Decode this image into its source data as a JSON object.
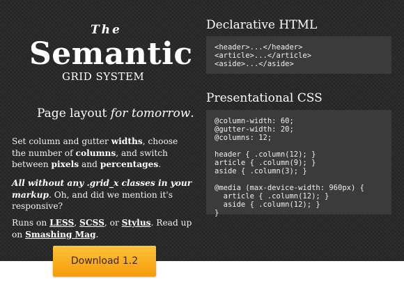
{
  "hero": {
    "the": "The",
    "title": "Semantic",
    "subtitle": "GRID SYSTEM",
    "tagline_prefix": "Page layout ",
    "tagline_emphasis": "for tomorrow",
    "tagline_suffix": "."
  },
  "intro": {
    "t1": "Set column and gutter ",
    "b1": "widths",
    "t2": ", choose the number of ",
    "b2": "columns",
    "t3": ", and switch between ",
    "b3": "pixels",
    "t4": " and ",
    "b4": "percentages",
    "t5": "."
  },
  "responsive": {
    "emphasis": "All without any .grid_x classes in your markup",
    "rest": ". Oh, and did we mention it's responsive?"
  },
  "runs": {
    "t1": "Runs on ",
    "less": "LESS",
    "t2": ", ",
    "scss": "SCSS",
    "t3": ", or ",
    "stylus": "Stylus",
    "t4": ". Read up on ",
    "smashing": "Smashing Mag",
    "t5": "."
  },
  "html_section": {
    "heading": "Declarative HTML",
    "code": "<header>...</header>\n<article>...</article>\n<aside>...</aside>"
  },
  "css_section": {
    "heading": "Presentational CSS",
    "code": "@column-width: 60;\n@gutter-width: 20;\n@columns: 12;\n\nheader { .column(12); }\narticle { .column(9); }\naside { .column(3); }\n\n@media (max-device-width: 960px) {\n  article { .column(12); }\n  aside { .column(12); }\n}"
  },
  "download": {
    "label": "Download 1.2"
  },
  "colors": {
    "background": "#262626",
    "code_background": "#3b3b3b",
    "button_top": "#ffc23a",
    "button_bottom": "#f49d0a"
  }
}
